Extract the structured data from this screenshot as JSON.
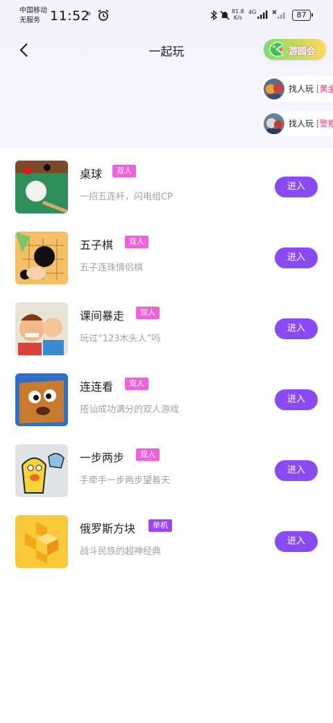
{
  "status_bar": {
    "carrier_line1": "中国移动",
    "carrier_line2": "无服务",
    "time": "11:52",
    "hd": "B",
    "net_speed_value": "81.8",
    "net_speed_unit": "K/s",
    "net_type": "4G",
    "battery": "87"
  },
  "header": {
    "title": "一起玩",
    "park_badge_label": "游园会"
  },
  "matching": [
    {
      "prefix": "找人玩 ",
      "game": "[黄金"
    },
    {
      "prefix": "找人玩 ",
      "game": "[警察"
    }
  ],
  "games": [
    {
      "name": "桌球",
      "tag": "双人",
      "desc": "一招五连杆，闪电组CP",
      "button": "进入"
    },
    {
      "name": "五子棋",
      "tag": "双人",
      "desc": "五子连珠情侣棋",
      "button": "进入"
    },
    {
      "name": "课间暴走",
      "tag": "双人",
      "desc": "玩过“123木头人”吗",
      "button": "进入"
    },
    {
      "name": "连连看",
      "tag": "双人",
      "desc": "搭讪成功满分的双人游戏",
      "button": "进入"
    },
    {
      "name": "一步两步",
      "tag": "双人",
      "desc": "手牵手一步两步望着天",
      "button": "进入"
    },
    {
      "name": "俄罗斯方块",
      "tag": "单机",
      "desc": "战斗民族的超神经典",
      "button": "进入"
    }
  ],
  "colors": {
    "accent": "#8a4cf2",
    "tag_duo": "#f062d9",
    "tag_solo": "#9b46f0",
    "highlight_text": "#e8458b"
  }
}
